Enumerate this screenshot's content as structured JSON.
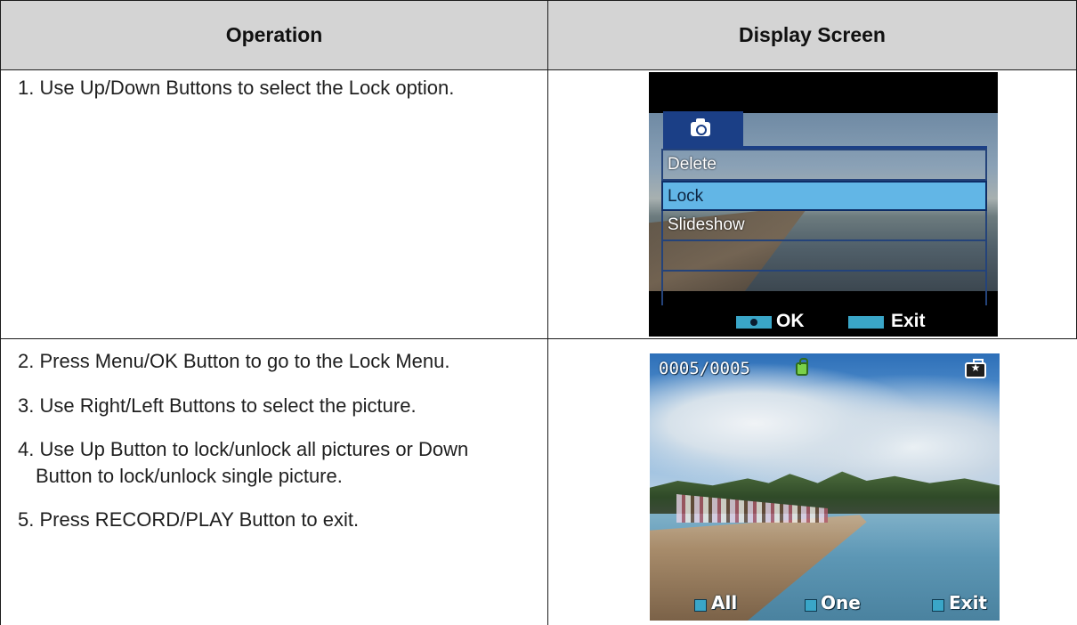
{
  "table": {
    "headers": {
      "operation": "Operation",
      "display": "Display Screen"
    },
    "row1": {
      "steps": [
        "1. Use Up/Down Buttons to select the Lock option."
      ]
    },
    "row2": {
      "steps": [
        "2. Press Menu/OK Button to go to the Lock Menu.",
        "3. Use Right/Left Buttons to select the picture.",
        "4. Use Up Button to lock/unlock all pictures or Down",
        "Button to lock/unlock single picture.",
        "5. Press RECORD/PLAY Button to exit."
      ]
    }
  },
  "screen1": {
    "menu_items": [
      "Delete",
      "Lock",
      "Slideshow"
    ],
    "selected_item": "Lock",
    "ok_label": "OK",
    "exit_label": "Exit"
  },
  "screen2": {
    "counter": "0005/0005",
    "all_label": "All",
    "one_label": "One",
    "exit_label": "Exit"
  },
  "colors": {
    "header_bg": "#d4d4d4",
    "menu_selected": "#62b6e6",
    "menu_border": "#24437a",
    "key_accent": "#3aa6c8"
  }
}
